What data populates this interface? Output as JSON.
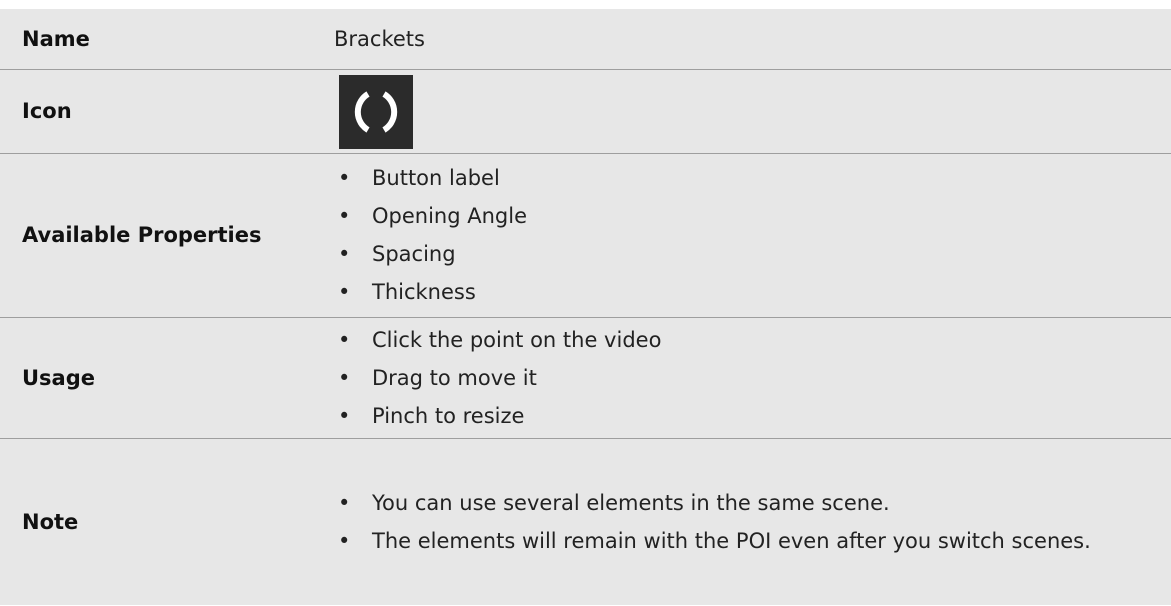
{
  "rows": {
    "name": {
      "label": "Name",
      "value": "Brackets"
    },
    "icon": {
      "label": "Icon",
      "icon_name": "brackets-icon",
      "icon_bg": "#2b2b2b",
      "icon_fg": "#ffffff"
    },
    "properties": {
      "label": "Available Properties",
      "items": [
        "Button label",
        "Opening Angle",
        "Spacing",
        "Thickness"
      ]
    },
    "usage": {
      "label": "Usage",
      "items": [
        "Click the point on the video",
        "Drag to move it",
        "Pinch to resize"
      ]
    },
    "note": {
      "label": "Note",
      "items": [
        "You can use several elements in the same scene.",
        "The elements will remain with the POI even after you switch scenes."
      ]
    }
  },
  "bullet_char": "•",
  "colors": {
    "table_bg": "#e7e7e7",
    "divider": "#9e9e9e",
    "text": "#111111"
  }
}
